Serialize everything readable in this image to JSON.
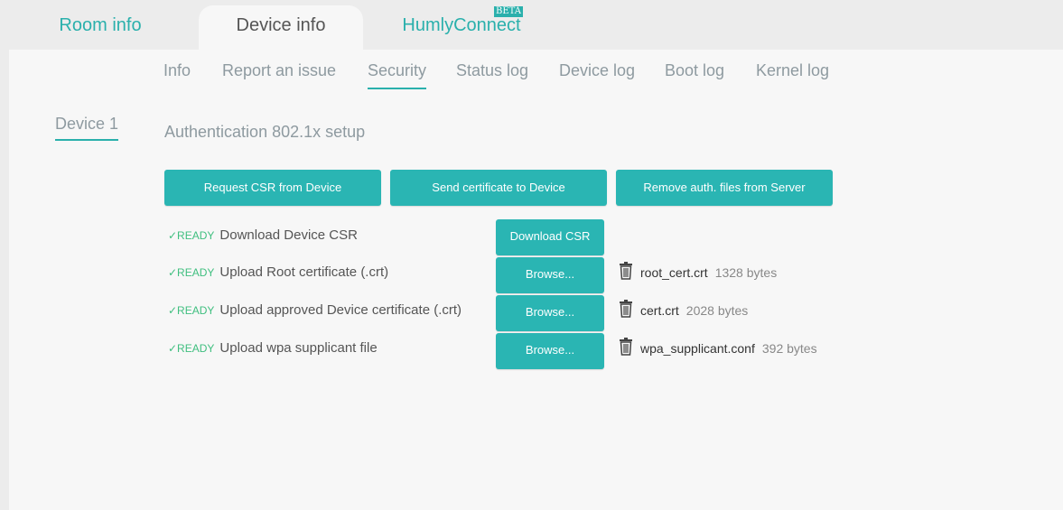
{
  "top_tabs": {
    "room_info": "Room info",
    "device_info": "Device info",
    "humly_connect": "HumlyConnect",
    "beta_badge": "BETA"
  },
  "sub_nav": [
    "Info",
    "Report an issue",
    "Security",
    "Status log",
    "Device log",
    "Boot log",
    "Kernel log"
  ],
  "sub_nav_active": "Security",
  "device_selector": "Device 1",
  "section_title": "Authentication 802.1x setup",
  "action_buttons": {
    "request_csr": "Request CSR from Device",
    "send_certificate": "Send certificate to Device",
    "remove_files": "Remove auth. files from Server"
  },
  "status_rows": [
    {
      "status": "✓READY",
      "label": "Download Device CSR",
      "button": "Download CSR"
    },
    {
      "status": "✓READY",
      "label": "Upload Root certificate (.crt)",
      "button": "Browse...",
      "file": {
        "name": "root_cert.crt",
        "size": "1328 bytes"
      }
    },
    {
      "status": "✓READY",
      "label": "Upload approved Device certificate (.crt)",
      "button": "Browse...",
      "file": {
        "name": "cert.crt",
        "size": "2028 bytes"
      }
    },
    {
      "status": "✓READY",
      "label": "Upload wpa supplicant file",
      "button": "Browse...",
      "file": {
        "name": "wpa_supplicant.conf",
        "size": "392 bytes"
      }
    }
  ],
  "colors": {
    "accent": "#2ab0ac",
    "ready": "#3fbf7f",
    "button": "#2ab5b3"
  },
  "icons": {
    "file_delete": "trash-icon"
  }
}
